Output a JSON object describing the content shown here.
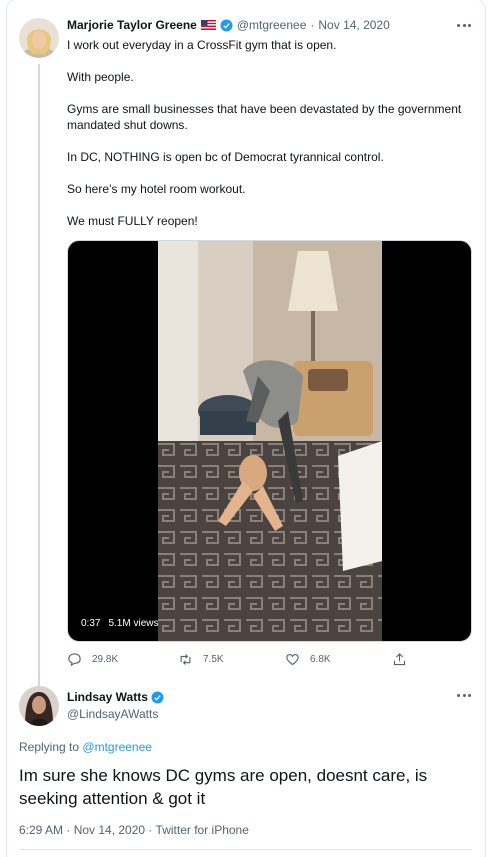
{
  "tweet1": {
    "author_name": "Marjorie Taylor Greene",
    "flag_icon": "us-flag-icon",
    "handle": "@mtgreenee",
    "separator": "·",
    "date": "Nov 14, 2020",
    "lines": [
      "I work out everyday in a CrossFit gym that is open.",
      "With people.",
      "Gyms are small businesses that have been devastated by the government mandated shut downs.",
      "In DC, NOTHING is open bc of Democrat tyrannical control.",
      "So here’s my hotel room workout.",
      "We must FULLY reopen!"
    ],
    "video": {
      "duration": "0:37",
      "views": "5.1M views"
    },
    "actions": {
      "replies": "29.8K",
      "retweets": "7.5K",
      "likes": "6.8K"
    }
  },
  "tweet2": {
    "author_name": "Lindsay Watts",
    "handle": "@LindsayAWatts",
    "replying_prefix": "Replying to",
    "replying_to": "@mtgreenee",
    "text": "Im sure she knows DC gyms are open, doesnt care, is seeking attention & got it",
    "meta": "6:29 AM · Nov 14, 2020 · Twitter for iPhone"
  },
  "colors": {
    "accent": "#1d9bf0",
    "muted": "#536471",
    "text": "#0f1419"
  }
}
